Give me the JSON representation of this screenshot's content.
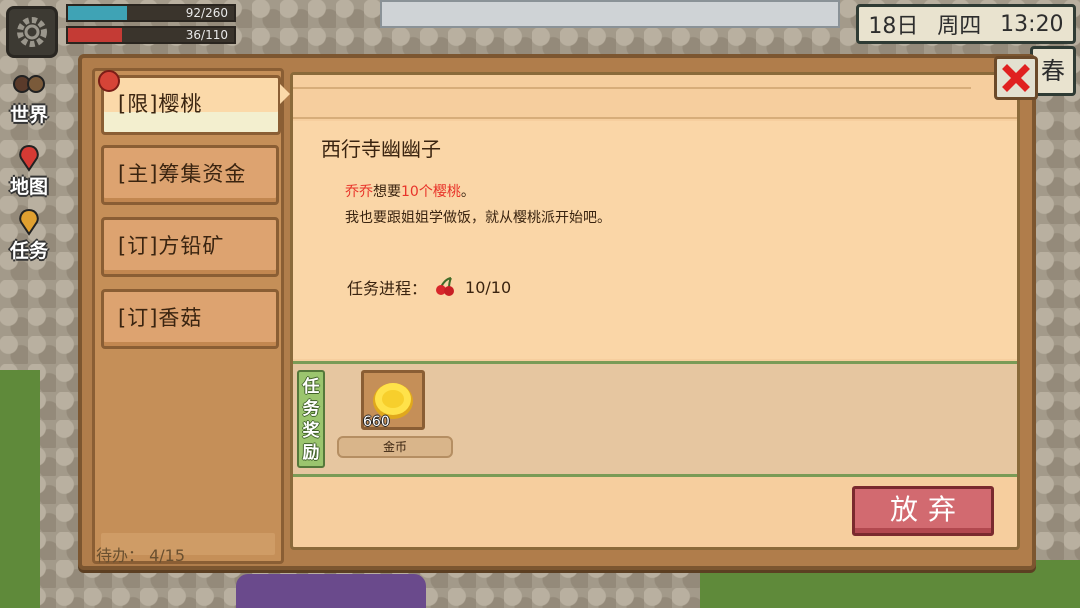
{
  "hud": {
    "hp": {
      "text": "92/260",
      "fraction": 0.354,
      "color": "#3fa3b5"
    },
    "energy": {
      "text": "36/110",
      "fraction": 0.327,
      "color": "#c43b35"
    },
    "side_buttons": [
      "世界",
      "地图",
      "任务"
    ],
    "clock": {
      "day": "18日",
      "weekday": "周四",
      "time": "13:20"
    },
    "season": "春"
  },
  "quest_list": {
    "items": [
      {
        "label": "[限]樱桃",
        "active": true,
        "badge": true
      },
      {
        "label": "[主]筹集资金",
        "active": false
      },
      {
        "label": "[订]方铅矿",
        "active": false
      },
      {
        "label": "[订]香菇",
        "active": false
      }
    ],
    "todo_label": "待办：",
    "todo_value": "4/15"
  },
  "quest_detail": {
    "npc": "西行寺幽幽子",
    "line1_name": "乔乔",
    "line1_mid": "想要",
    "line1_item": "10个樱桃",
    "line1_end": "。",
    "line2": "我也要跟姐姐学做饭，就从樱桃派开始吧。",
    "progress_label": "任务进程：",
    "progress_icon": "cherry-icon",
    "progress_value": "10/10"
  },
  "reward": {
    "tag": "任务奖励",
    "item_icon": "gold-coin-icon",
    "count": "660",
    "name": "金币"
  },
  "buttons": {
    "abandon": "放弃"
  },
  "colors": {
    "accent_red": "#e8342a",
    "panel": "#f6ce9e",
    "reward_green": "#9bc56e"
  }
}
